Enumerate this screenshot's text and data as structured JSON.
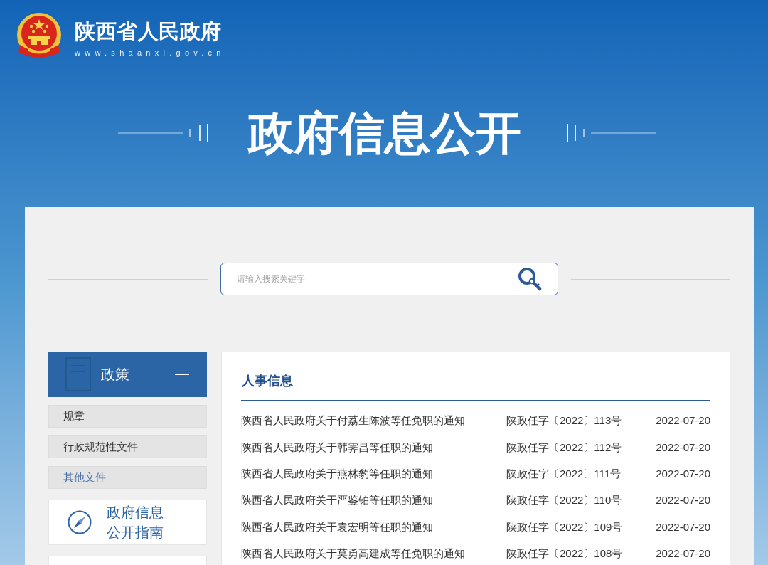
{
  "header": {
    "site_title": "陕西省人民政府",
    "site_url": "www.shaanxi.gov.cn"
  },
  "banner": {
    "title": "政府信息公开"
  },
  "search": {
    "placeholder": "请输入搜索关键字"
  },
  "sidebar": {
    "section": {
      "label": "政策",
      "expanded": true
    },
    "items": [
      {
        "label": "规章",
        "selected": false
      },
      {
        "label": "行政规范性文件",
        "selected": false
      },
      {
        "label": "其他文件",
        "selected": true
      }
    ],
    "cards": [
      {
        "label": "政府信息公开指南"
      }
    ]
  },
  "content": {
    "title": "人事信息",
    "rows": [
      {
        "title": "陕西省人民政府关于付荔生陈波等任免职的通知",
        "doc_number": "陕政任字〔2022〕113号",
        "date": "2022-07-20"
      },
      {
        "title": "陕西省人民政府关于韩霁昌等任职的通知",
        "doc_number": "陕政任字〔2022〕112号",
        "date": "2022-07-20"
      },
      {
        "title": "陕西省人民政府关于燕林豹等任职的通知",
        "doc_number": "陕政任字〔2022〕111号",
        "date": "2022-07-20"
      },
      {
        "title": "陕西省人民政府关于严鉴铂等任职的通知",
        "doc_number": "陕政任字〔2022〕110号",
        "date": "2022-07-20"
      },
      {
        "title": "陕西省人民政府关于袁宏明等任职的通知",
        "doc_number": "陕政任字〔2022〕109号",
        "date": "2022-07-20"
      },
      {
        "title": "陕西省人民政府关于莫勇高建成等任免职的通知",
        "doc_number": "陕政任字〔2022〕108号",
        "date": "2022-07-20"
      }
    ]
  }
}
